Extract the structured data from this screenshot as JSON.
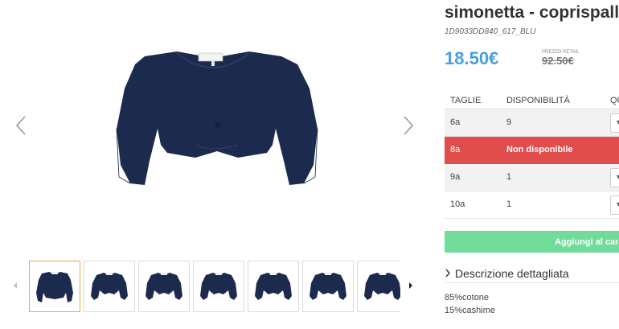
{
  "product": {
    "title": "simonetta - coprispalla",
    "sku": "1D9033DD840_617_BLU",
    "price": "18.50€",
    "retail_label": "PREZZO RETAIL",
    "retail_price": "92.50€"
  },
  "gallery": {
    "thumbnail_count": 7,
    "active_thumbnail": 1,
    "garment_color": "#1c2a4e",
    "active_border_color": "#e8a948"
  },
  "sizes_table": {
    "headers": [
      "TAGLIE",
      "DISPONIBILITÀ",
      "QU"
    ],
    "rows": [
      {
        "size": "6a",
        "availability": "9",
        "status": "available"
      },
      {
        "size": "8a",
        "availability": "Non disponibile",
        "status": "unavailable"
      },
      {
        "size": "9a",
        "availability": "1",
        "status": "available"
      },
      {
        "size": "10a",
        "availability": "1",
        "status": "available"
      }
    ],
    "unavailable_color": "#e14c4c"
  },
  "cart": {
    "add_label": "Aggiungi al carre",
    "button_color": "#6fdc9a"
  },
  "description": {
    "toggle_label": "Descrizione dettagliata",
    "lines": [
      "85%cotone",
      "15%cashime"
    ]
  },
  "colors": {
    "price": "#4aa0dc"
  }
}
